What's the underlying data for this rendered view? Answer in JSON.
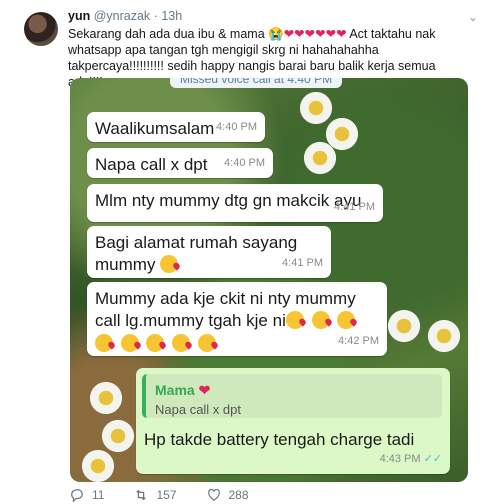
{
  "tweet": {
    "name": "yun",
    "handle": "@ynrazak",
    "time": "13h",
    "text_part1": "Sekarang dah ada dua ibu & mama 😭",
    "hearts": "❤❤❤❤❤❤",
    "text_part2": " Act taktahu nak whatsapp apa tangan tgh mengigil skrg ni hahahahahha takpercaya!!!!!!!!!! sedih happy nangis barai baru balik kerja semua ada!!!!",
    "replies": "11",
    "retweets": "157",
    "likes": "288"
  },
  "chat": {
    "missed_call": "Missed voice call at 4:40 PM",
    "messages": [
      {
        "text": "Waalikumsalam",
        "time": "4:40 PM"
      },
      {
        "text": "Napa call x dpt",
        "time": "4:40 PM"
      },
      {
        "text": "Mlm nty mummy dtg gn makcik ayu",
        "time": "4:41 PM"
      },
      {
        "text": "Bagi alamat rumah sayang",
        "text2": "mummy",
        "time": "4:41 PM"
      },
      {
        "text": "Mummy ada kje ckit ni nty mummy",
        "text2": "call lg.mummy tgah kje ni",
        "time": "4:42 PM"
      }
    ],
    "reply": {
      "quoted_name": "Mama",
      "quoted_text": "Napa call x dpt",
      "text": "Hp takde battery tengah charge tadi",
      "time": "4:43 PM"
    }
  },
  "icons": [
    "reply-icon",
    "retweet-icon",
    "like-icon",
    "caret-down-icon"
  ]
}
